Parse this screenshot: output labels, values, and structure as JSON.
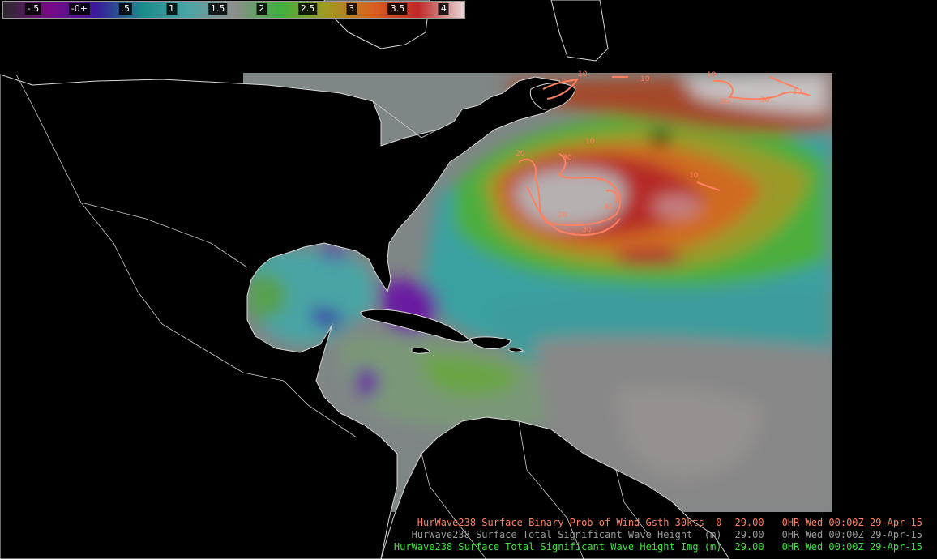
{
  "colorbar": {
    "ticks": [
      {
        "label": "-.5",
        "pct": 6.5
      },
      {
        "label": "-0+",
        "pct": 16.5
      },
      {
        "label": ".5",
        "pct": 26.5
      },
      {
        "label": "1",
        "pct": 36.5
      },
      {
        "label": "1.5",
        "pct": 46.5
      },
      {
        "label": "2",
        "pct": 56.0
      },
      {
        "label": "2.5",
        "pct": 66.0
      },
      {
        "label": "3",
        "pct": 75.5
      },
      {
        "label": "3.5",
        "pct": 85.5
      },
      {
        "label": "4",
        "pct": 95.5
      }
    ],
    "colors": [
      "#2a2a2a",
      "#7a0a88",
      "#3a1a9a",
      "#1a8a8a",
      "#4aa6a6",
      "#8e8e8e",
      "#3eb03e",
      "#9e9a22",
      "#d8621e",
      "#c02828",
      "#e8d8d8"
    ]
  },
  "contour_labels": [
    "10",
    "20",
    "30",
    "40",
    "10",
    "20",
    "30",
    "10",
    "20",
    "30",
    "10",
    "10",
    "10"
  ],
  "legend": [
    {
      "product": "HurWave238 Surface Binary Prob of Wind Gsth 30kts  0",
      "level": "29.00",
      "time": "0HR Wed 00:00Z 29-Apr-15",
      "color": "#ff8060"
    },
    {
      "product": "HurWave238 Surface Total Significant Wave Height  (m)",
      "level": "29.00",
      "time": "0HR Wed 00:00Z 29-Apr-15",
      "color": "#9a9a9a"
    },
    {
      "product": "HurWave238 Surface Total Significant Wave Height Img (m)",
      "level": "29.00",
      "time": "0HR Wed 00:00Z 29-Apr-15",
      "color": "#3ee03e"
    }
  ]
}
